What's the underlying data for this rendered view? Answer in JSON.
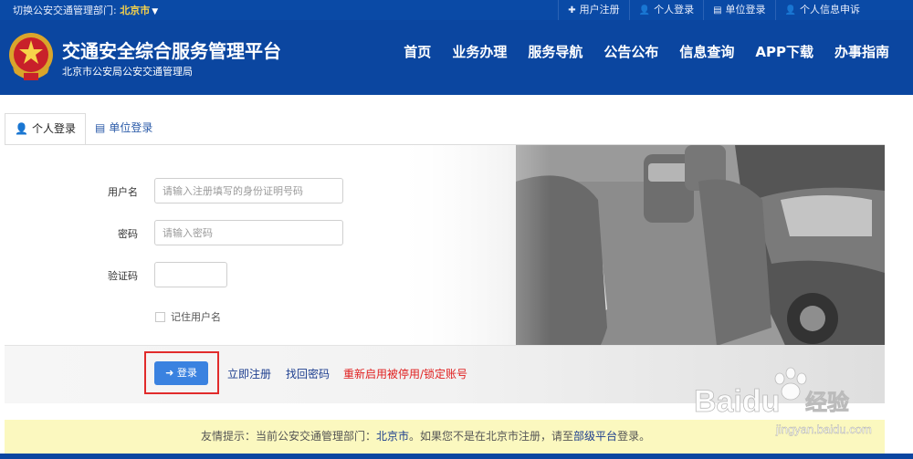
{
  "topbar": {
    "dept_label": "切换公安交通管理部门: ",
    "dept_city": "北京市",
    "links": [
      {
        "icon": "plus-icon",
        "label": "用户注册"
      },
      {
        "icon": "user-icon",
        "label": "个人登录"
      },
      {
        "icon": "document-icon",
        "label": "单位登录"
      },
      {
        "icon": "user-icon",
        "label": "个人信息申诉"
      }
    ]
  },
  "header": {
    "title": "交通安全综合服务管理平台",
    "subtitle": "北京市公安局公安交通管理局",
    "nav": [
      "首页",
      "业务办理",
      "服务导航",
      "公告公布",
      "信息查询",
      "APP下载",
      "办事指南"
    ]
  },
  "tabs": {
    "personal": "个人登录",
    "company": "单位登录"
  },
  "form": {
    "username_label": "用户名",
    "username_placeholder": "请输入注册填写的身份证明号码",
    "password_label": "密码",
    "password_placeholder": "请输入密码",
    "captcha_label": "验证码",
    "remember_label": "记住用户名"
  },
  "actions": {
    "login": "登录",
    "register": "立即注册",
    "recover": "找回密码",
    "reactivate": "重新启用被停用/锁定账号"
  },
  "notice": {
    "prefix": "友情提示：当前公安交通管理部门：",
    "city": "北京市",
    "middle": "。如果您不是在北京市注册，请至",
    "platform": "部级平台",
    "suffix": "登录。"
  },
  "watermark": {
    "brand": "Baidu",
    "brand_cn": "经验",
    "url": "jingyan.baidu.com"
  },
  "colors": {
    "header_bg": "#0b46a0",
    "accent_yellow": "#f7d34a",
    "login_button": "#3a82e0",
    "highlight_red": "#e12b2b",
    "notice_bg": "#fbf8bf"
  }
}
